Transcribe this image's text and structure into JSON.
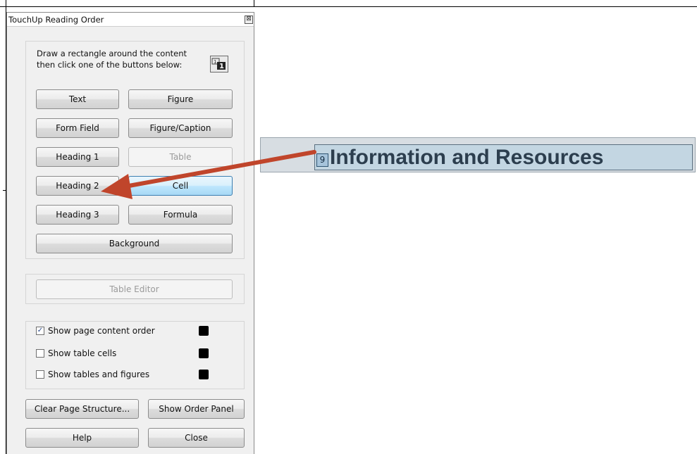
{
  "panel": {
    "title": "TouchUp Reading Order",
    "close_glyph": "⊠",
    "instructions": "Draw a rectangle around the content then click one of the buttons below:",
    "buttons": {
      "text": "Text",
      "figure": "Figure",
      "form_field": "Form Field",
      "figure_caption": "Figure/Caption",
      "heading1": "Heading 1",
      "table": "Table",
      "heading2": "Heading 2",
      "cell": "Cell",
      "heading3": "Heading 3",
      "formula": "Formula",
      "background": "Background",
      "table_editor": "Table Editor",
      "clear_page_structure": "Clear Page Structure...",
      "show_order_panel": "Show Order Panel",
      "help": "Help",
      "close": "Close"
    },
    "options": [
      {
        "label": "Show page content order",
        "checked": true,
        "color": "#000000"
      },
      {
        "label": "Show table cells",
        "checked": false,
        "color": "#000000"
      },
      {
        "label": "Show tables and figures",
        "checked": false,
        "color": "#000000"
      }
    ]
  },
  "document": {
    "order_number": "9",
    "heading": "Information and Resources"
  },
  "colors": {
    "arrow": "#c0452b",
    "highlight_box": "#c3d6e2",
    "badge": "#a6c4db"
  }
}
